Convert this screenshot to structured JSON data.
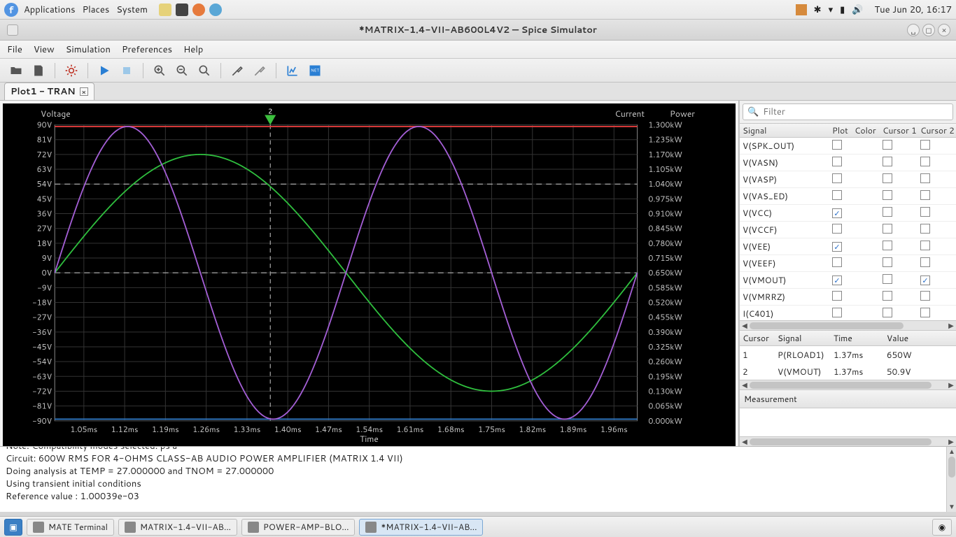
{
  "sysbar": {
    "menus": [
      "Applications",
      "Places",
      "System"
    ],
    "clock": "Tue Jun 20, 16:17"
  },
  "window": {
    "title": "*MATRIX-1.4-VII-AB600L4V2 — Spice Simulator"
  },
  "menubar": [
    "File",
    "View",
    "Simulation",
    "Preferences",
    "Help"
  ],
  "tab": {
    "label": "Plot1 - TRAN"
  },
  "plot": {
    "voltage_label": "Voltage",
    "current_label": "Current",
    "power_label": "Power",
    "time_label": "Time",
    "cursor_marker": "2"
  },
  "filter": {
    "placeholder": "Filter"
  },
  "signal_headers": [
    "Signal",
    "Plot",
    "Color",
    "Cursor 1",
    "Cursor 2"
  ],
  "signals": [
    {
      "name": "V(SPK_OUT)",
      "plot": false,
      "color": "",
      "c1": false,
      "c2": false
    },
    {
      "name": "V(VASN)",
      "plot": false,
      "color": "",
      "c1": false,
      "c2": false
    },
    {
      "name": "V(VASP)",
      "plot": false,
      "color": "",
      "c1": false,
      "c2": false
    },
    {
      "name": "V(VAS_ED)",
      "plot": false,
      "color": "",
      "c1": false,
      "c2": false
    },
    {
      "name": "V(VCC)",
      "plot": true,
      "color": "#e23c3c",
      "c1": false,
      "c2": false
    },
    {
      "name": "V(VCCF)",
      "plot": false,
      "color": "",
      "c1": false,
      "c2": false
    },
    {
      "name": "V(VEE)",
      "plot": true,
      "color": "#2f78c4",
      "c1": false,
      "c2": false
    },
    {
      "name": "V(VEEF)",
      "plot": false,
      "color": "",
      "c1": false,
      "c2": false
    },
    {
      "name": "V(VMOUT)",
      "plot": true,
      "color": "#2fbf3e",
      "c1": false,
      "c2": true
    },
    {
      "name": "V(VMRRZ)",
      "plot": false,
      "color": "",
      "c1": false,
      "c2": false
    },
    {
      "name": "I(C401)",
      "plot": false,
      "color": "",
      "c1": false,
      "c2": false
    }
  ],
  "cursor_headers": [
    "Cursor",
    "Signal",
    "Time",
    "Value"
  ],
  "cursors": [
    {
      "id": "1",
      "signal": "P(RLOAD1)",
      "time": "1.37ms",
      "value": "650W"
    },
    {
      "id": "2",
      "signal": "V(VMOUT)",
      "time": "1.37ms",
      "value": "50.9V"
    }
  ],
  "measurement_header": "Measurement",
  "console_lines": [
    "Note: Compatibility modes selected: ps a",
    "Circuit: 600W RMS FOR 4-OHMS CLASS-AB AUDIO POWER AMPLIFIER (MATRIX 1.4 VII)",
    "Doing analysis at TEMP = 27.000000 and TNOM = 27.000000",
    "Using transient initial conditions",
    " Reference value :  1.00039e-03"
  ],
  "taskbar": {
    "items": [
      {
        "label": "MATE Terminal",
        "icon": "#444"
      },
      {
        "label": "MATRIX-1.4-VII-AB...",
        "icon": "#3a6fb0"
      },
      {
        "label": "POWER-AMP-BLO...",
        "icon": "#cf6a2c"
      },
      {
        "label": "*MATRIX-1.4-VII-AB...",
        "icon": "#3a9fd0"
      }
    ]
  },
  "chart_data": {
    "type": "line",
    "xlabel": "Time",
    "x_ticks": [
      "1.05ms",
      "1.12ms",
      "1.19ms",
      "1.26ms",
      "1.33ms",
      "1.40ms",
      "1.47ms",
      "1.54ms",
      "1.61ms",
      "1.68ms",
      "1.75ms",
      "1.82ms",
      "1.89ms",
      "1.96ms"
    ],
    "x_range_ms": [
      1.0,
      2.0
    ],
    "left_axis": {
      "label": "Voltage",
      "unit": "V",
      "ticks": [
        90,
        81,
        72,
        63,
        54,
        45,
        36,
        27,
        18,
        9,
        0,
        -9,
        -18,
        -27,
        -36,
        -45,
        -54,
        -63,
        -72,
        -81,
        -90
      ],
      "range": [
        -90,
        90
      ]
    },
    "right_axis": {
      "label": "Power",
      "unit": "kW",
      "ticks": [
        1.3,
        1.235,
        1.17,
        1.105,
        1.04,
        0.975,
        0.91,
        0.845,
        0.78,
        0.715,
        0.65,
        0.585,
        0.52,
        0.455,
        0.39,
        0.325,
        0.26,
        0.195,
        0.13,
        0.065,
        0.0
      ],
      "range": [
        0.0,
        1.3
      ]
    },
    "cursor2_x_ms": 1.37,
    "dashed_refs_v": [
      54,
      0
    ],
    "series": [
      {
        "name": "V(VCC)",
        "axis": "left",
        "color": "#e23c3c",
        "flat_value": 89
      },
      {
        "name": "V(VEE)",
        "axis": "left",
        "color": "#2f78c4",
        "flat_value": -89
      },
      {
        "name": "V(VMOUT)",
        "axis": "left",
        "color": "#2fbf3e",
        "shape": "sine",
        "amplitude": 72,
        "period_ms": 1.0,
        "phase_zero_ms": 1.0
      },
      {
        "name": "V(purple)",
        "axis": "left",
        "color": "#a45fd6",
        "shape": "sine",
        "amplitude": 89,
        "period_ms": 0.5,
        "phase_zero_ms": 1.0
      }
    ]
  }
}
